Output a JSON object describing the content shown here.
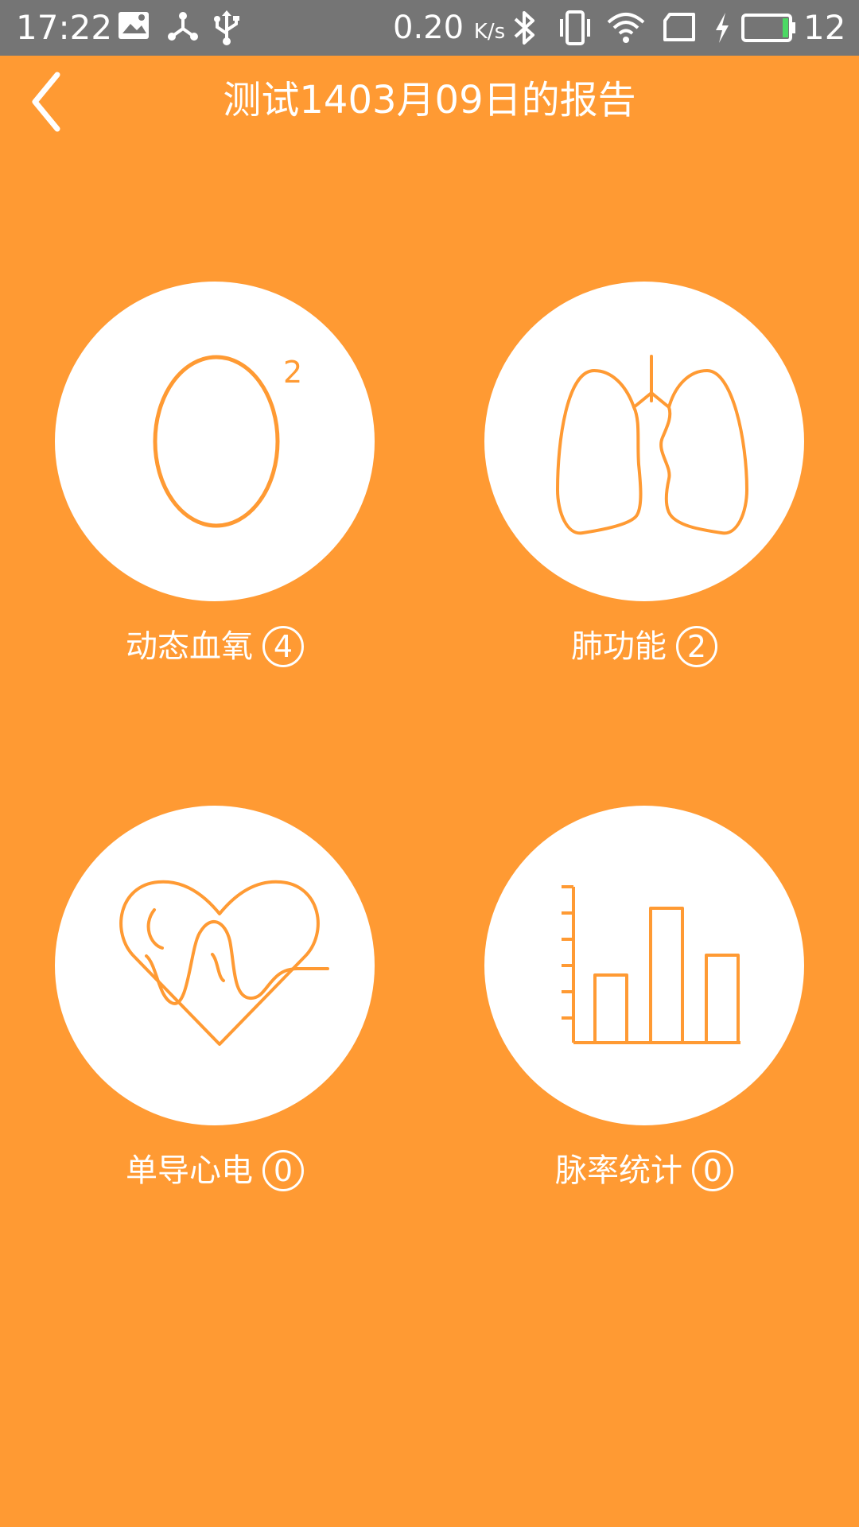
{
  "status_bar": {
    "time": "17:22",
    "network_speed": "0.20",
    "network_unit": "K/s",
    "battery_level": "12",
    "icons": [
      "image-icon",
      "share-icon",
      "usb-icon",
      "bluetooth-icon",
      "vibrate-icon",
      "wifi-icon",
      "sim-card-icon",
      "charging-icon",
      "battery-icon"
    ]
  },
  "header": {
    "back_icon": "chevron-left-icon",
    "title": "测试1403月09日的报告"
  },
  "tiles": [
    {
      "label": "动态血氧",
      "count": "4",
      "icon": "oxygen-o2-icon"
    },
    {
      "label": "肺功能",
      "count": "2",
      "icon": "lungs-icon"
    },
    {
      "label": "单导心电",
      "count": "0",
      "icon": "heart-ecg-icon"
    },
    {
      "label": "脉率统计",
      "count": "0",
      "icon": "bar-chart-icon"
    }
  ],
  "colors": {
    "background": "#FF9A33",
    "status_bar": "#757575",
    "tile_circle": "#FFFFFF",
    "icon_stroke": "#FF9A33",
    "text": "#FFFFFF",
    "battery_fill": "#4CD964"
  }
}
